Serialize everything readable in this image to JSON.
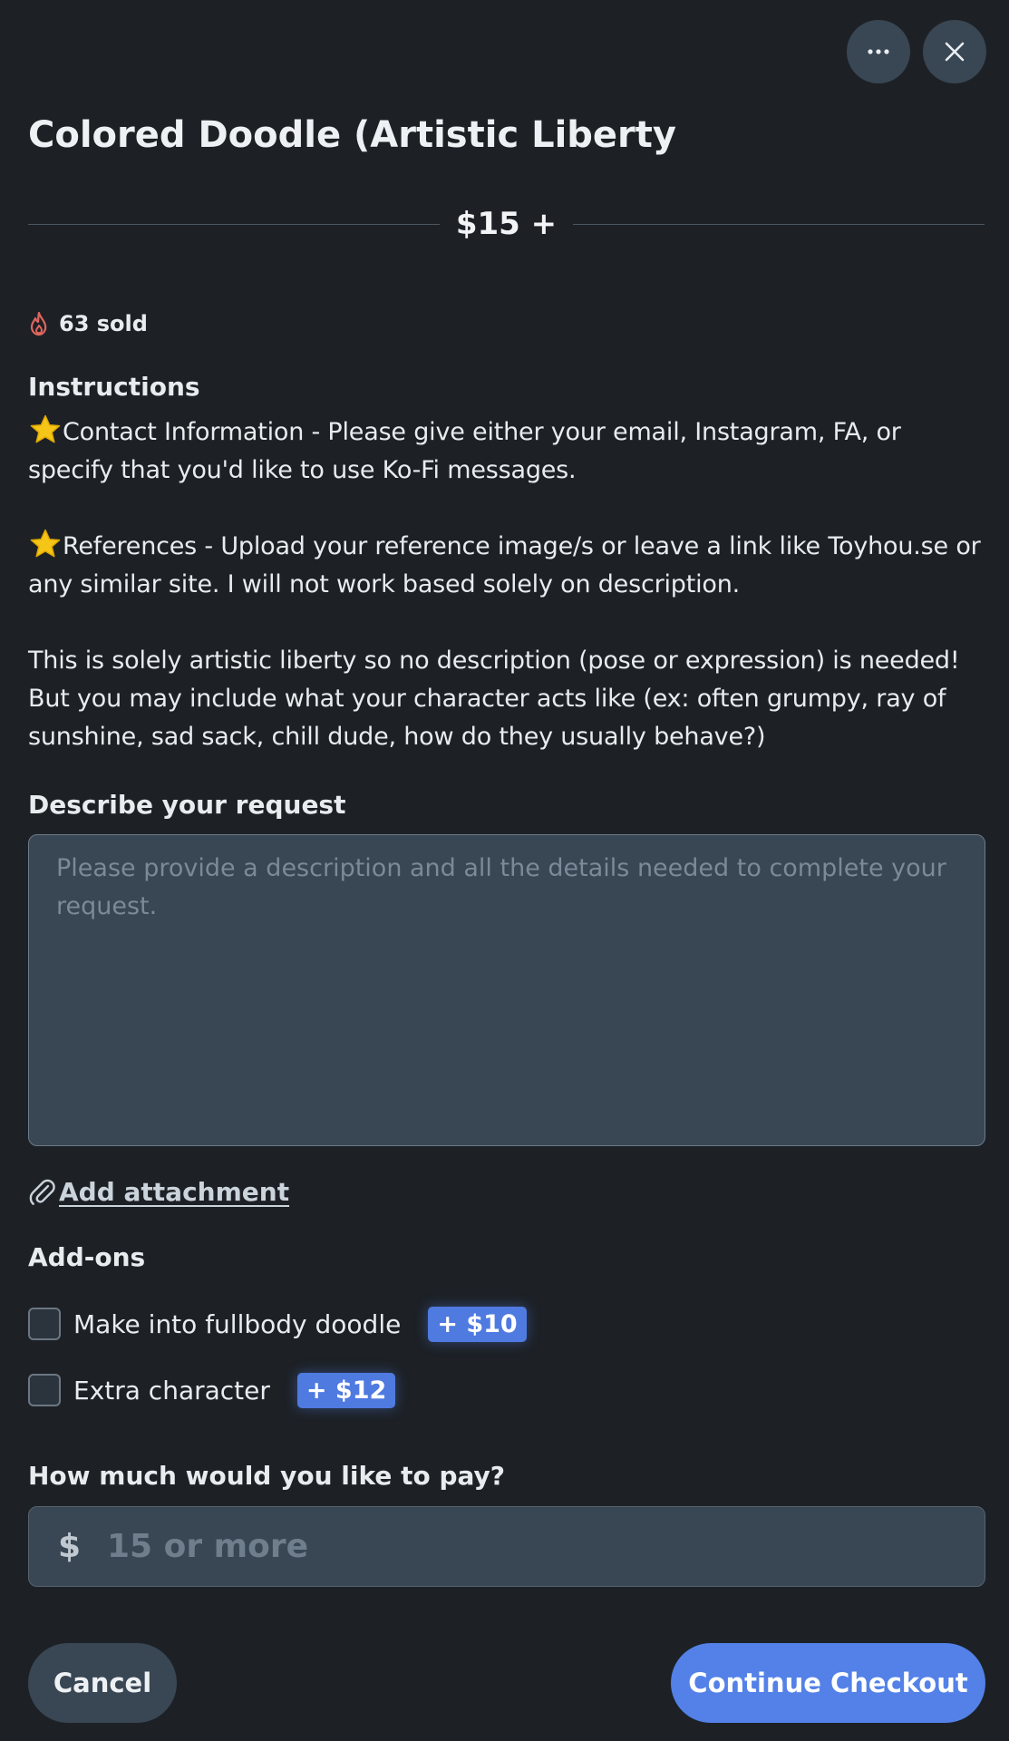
{
  "header": {
    "more_icon": "ellipsis-icon",
    "close_icon": "close-icon",
    "title": "Colored Doodle (Artistic Liberty",
    "price": "$15 +"
  },
  "stats": {
    "sold_icon": "flame-icon",
    "sold_text": "63 sold",
    "flame_color": "#e0655f"
  },
  "instructions": {
    "heading": "Instructions",
    "star_icon": "star-emoji",
    "para1": "Contact Information - Please give either your email, Instagram, FA, or specify that you'd like to use Ko-Fi messages.",
    "para2": "References - Upload your reference image/s or leave a link like Toyhou.se or any similar site. I will not work based solely on description.",
    "para3": "This is solely artistic liberty so no description (pose or expression) is needed! But you may include what your character acts like (ex: often grumpy, ray of sunshine, sad sack, chill dude, how do they usually behave?)"
  },
  "request": {
    "heading": "Describe your request",
    "placeholder": "Please provide a description and all the details needed to complete your request.",
    "value": ""
  },
  "attachment": {
    "icon": "paperclip-icon",
    "label": "Add attachment"
  },
  "addons": {
    "heading": "Add-ons",
    "items": [
      {
        "label": "Make into fullbody doodle",
        "price": "+ $10",
        "checked": false
      },
      {
        "label": "Extra character",
        "price": "+ $12",
        "checked": false
      }
    ]
  },
  "payment": {
    "heading": "How much would you like to pay?",
    "currency_symbol": "$",
    "placeholder": "15 or more",
    "value": ""
  },
  "actions": {
    "cancel_label": "Cancel",
    "continue_label": "Continue Checkout"
  },
  "colors": {
    "background": "#1d2126",
    "field": "#394653",
    "accent": "#5381e8",
    "badge": "#4f7ae0"
  }
}
